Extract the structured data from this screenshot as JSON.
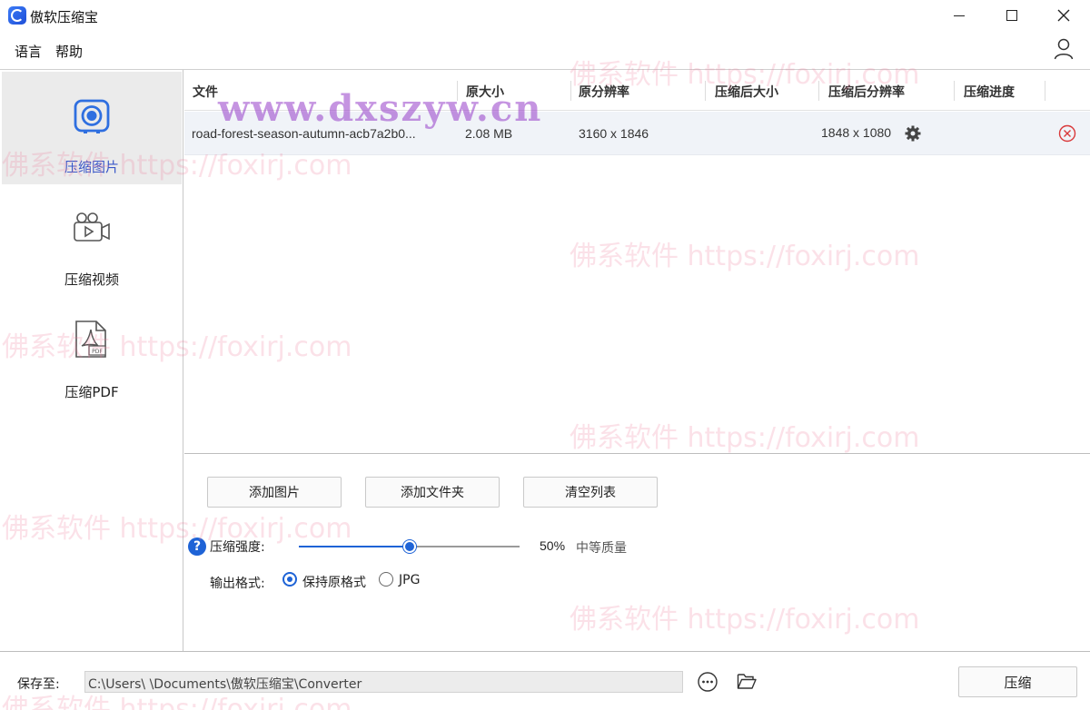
{
  "window": {
    "title": "傲软压缩宝"
  },
  "menu": {
    "language": "语言",
    "help": "帮助"
  },
  "sidebar": {
    "items": [
      {
        "label": "压缩图片",
        "icon": "camera-icon",
        "active": true
      },
      {
        "label": "压缩视频",
        "icon": "video-camera-icon",
        "active": false
      },
      {
        "label": "压缩PDF",
        "icon": "pdf-file-icon",
        "active": false
      }
    ]
  },
  "table": {
    "columns": [
      "文件",
      "原大小",
      "原分辨率",
      "压缩后大小",
      "压缩后分辨率",
      "压缩进度"
    ],
    "rows": [
      {
        "file": "road-forest-season-autumn-acb7a2b0...",
        "original_size": "2.08 MB",
        "original_resolution": "3160 x 1846",
        "compressed_size": "",
        "compressed_resolution": "1848 x 1080",
        "progress": ""
      }
    ]
  },
  "actions": {
    "add_image": "添加图片",
    "add_folder": "添加文件夹",
    "clear_list": "清空列表"
  },
  "compression": {
    "label": "压缩强度:",
    "value": 50,
    "value_text": "50%",
    "quality_text": "中等质量"
  },
  "output_format": {
    "label": "输出格式:",
    "options": [
      "保持原格式",
      "JPG"
    ],
    "selected": "保持原格式"
  },
  "save": {
    "label": "保存至:",
    "path": "C:\\Users\\      \\Documents\\傲软压缩宝\\Converter",
    "compress_button": "压缩"
  },
  "watermarks": {
    "site": "www.dxszyw.cn",
    "brand": "佛系软件 https://foxirj.com"
  },
  "colors": {
    "accent": "#1e63d6",
    "active_sidebar_bg": "#ebebeb",
    "active_label": "#3a57c8",
    "remove": "#d9383a"
  }
}
